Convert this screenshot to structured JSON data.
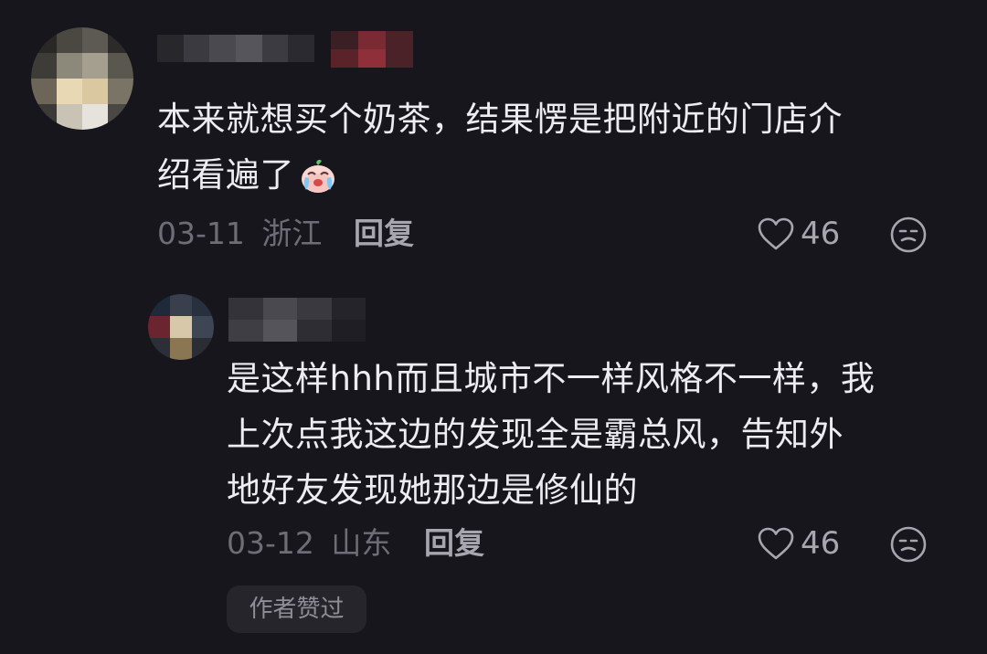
{
  "comments": [
    {
      "text_line1": "本来就想买个奶茶，结果愣是把附近的门店介",
      "text_line2": "绍看遍了",
      "emoji": "crying-face-emoji",
      "date": "03-11",
      "location": "浙江",
      "reply_label": "回复",
      "like_count": "46"
    },
    {
      "text_line1": "是这样hhh而且城市不一样风格不一样，我",
      "text_line2": "上次点我这边的发现全是霸总风，告知外",
      "text_line3": "地好友发现她那边是修仙的",
      "date": "03-12",
      "location": "山东",
      "reply_label": "回复",
      "like_count": "46",
      "badge": "作者赞过"
    }
  ],
  "colors": {
    "background": "#17161c",
    "text": "#ececf1",
    "meta": "#6e6d75",
    "badge_bg": "#26252b"
  }
}
